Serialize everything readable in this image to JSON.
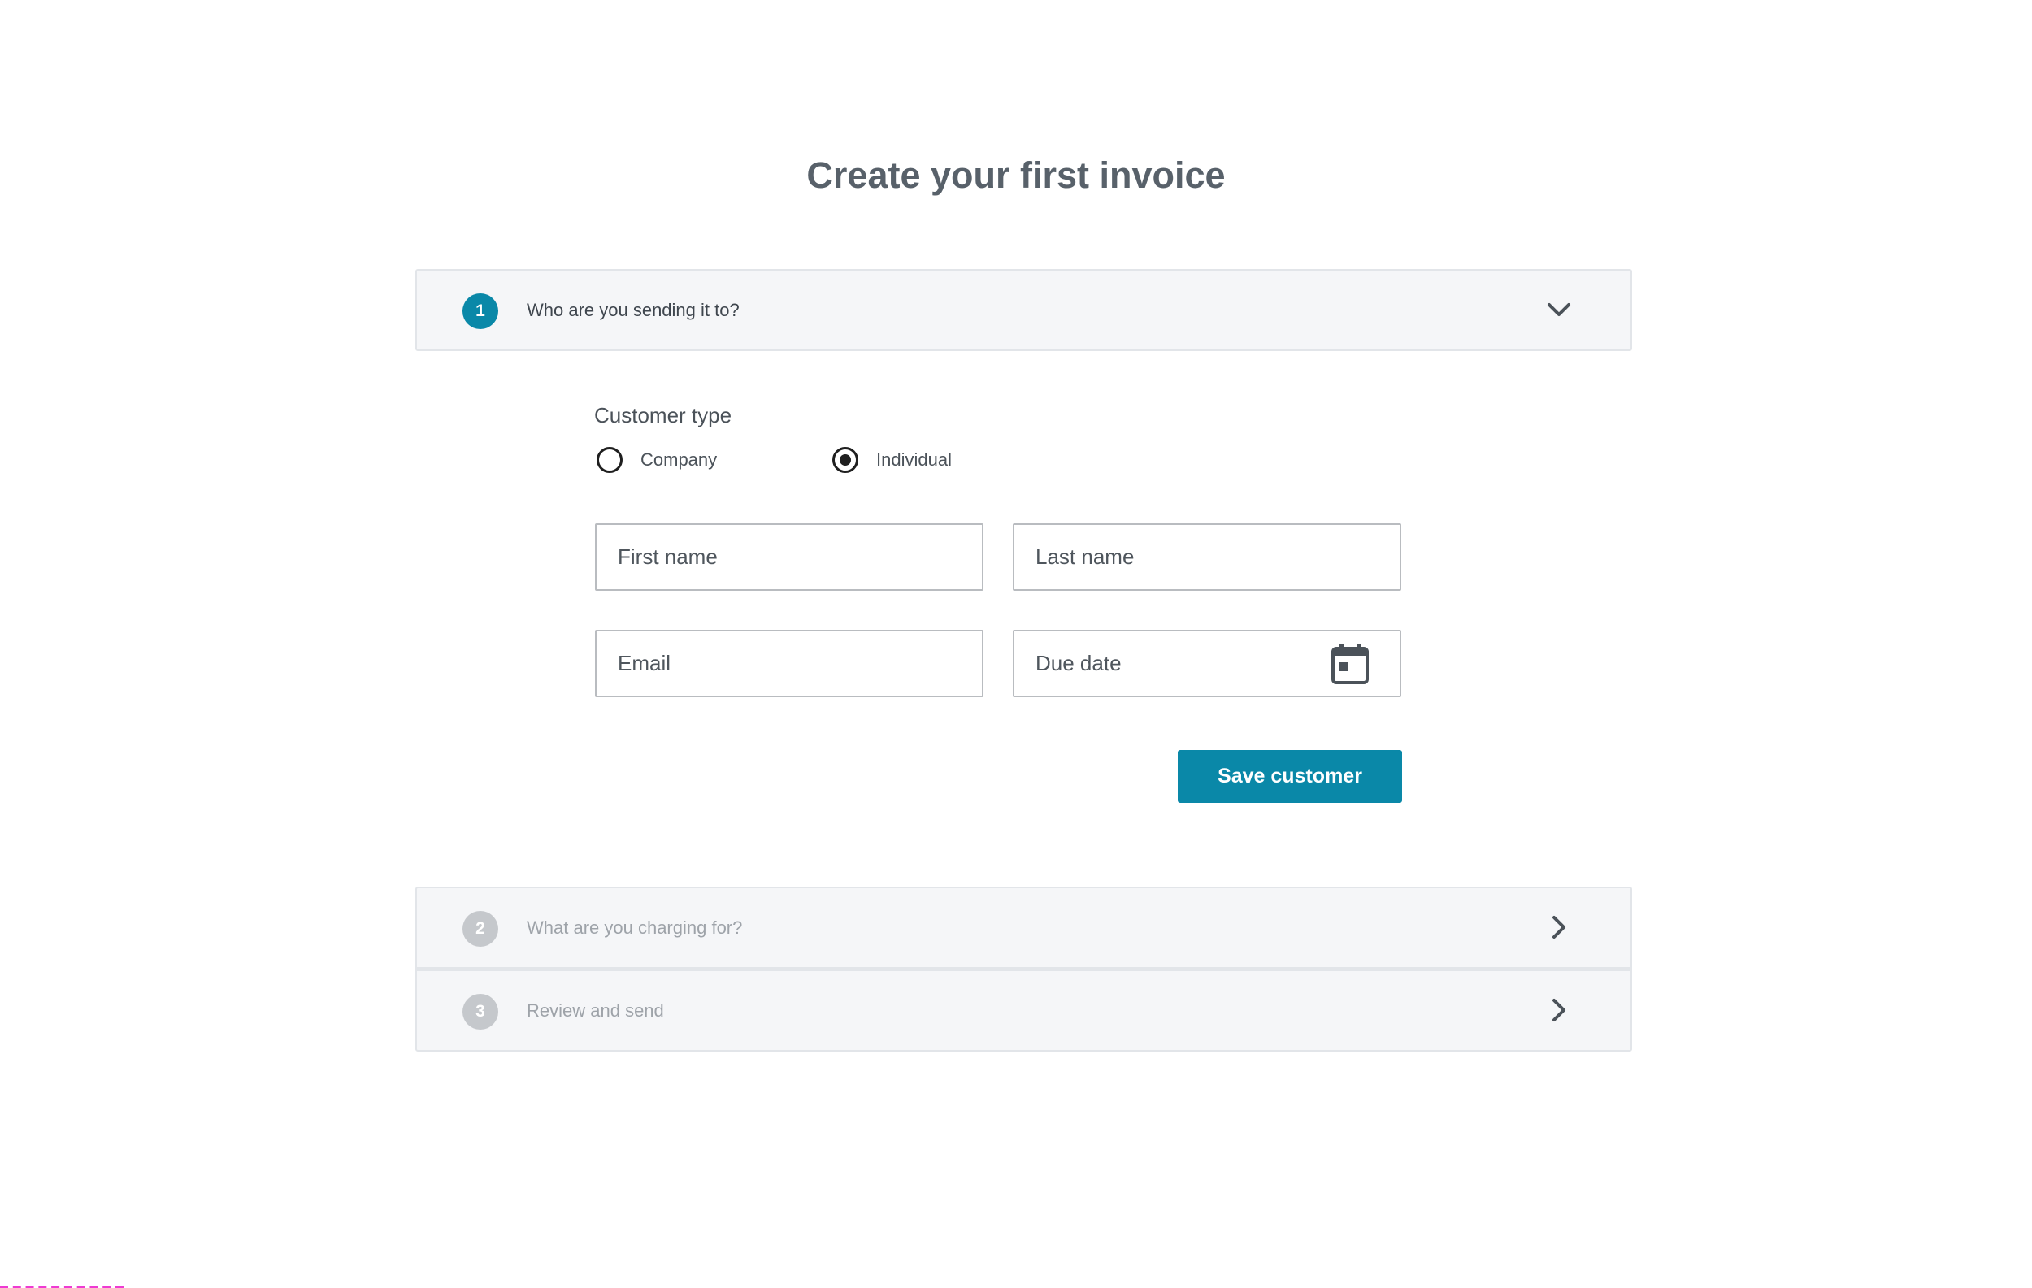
{
  "page": {
    "title": "Create your first invoice"
  },
  "steps": [
    {
      "number": "1",
      "label": "Who are you sending it to?",
      "state": "expanded"
    },
    {
      "number": "2",
      "label": "What are you charging for?",
      "state": "collapsed"
    },
    {
      "number": "3",
      "label": "Review and send",
      "state": "collapsed"
    }
  ],
  "customer_form": {
    "customer_type_label": "Customer type",
    "options": [
      {
        "label": "Company",
        "selected": false
      },
      {
        "label": "Individual",
        "selected": true
      }
    ],
    "fields": {
      "first_name": {
        "value": "",
        "placeholder": "First name"
      },
      "last_name": {
        "value": "",
        "placeholder": "Last name"
      },
      "email": {
        "value": "",
        "placeholder": "Email"
      },
      "due_date": {
        "value": "",
        "placeholder": "Due date",
        "icon": "calendar-icon"
      }
    },
    "save_label": "Save customer"
  },
  "colors": {
    "accent": "#0a88a8",
    "inactive_step": "#c5c8cc",
    "title_text": "#58616a",
    "step_background": "#f5f6f8"
  }
}
